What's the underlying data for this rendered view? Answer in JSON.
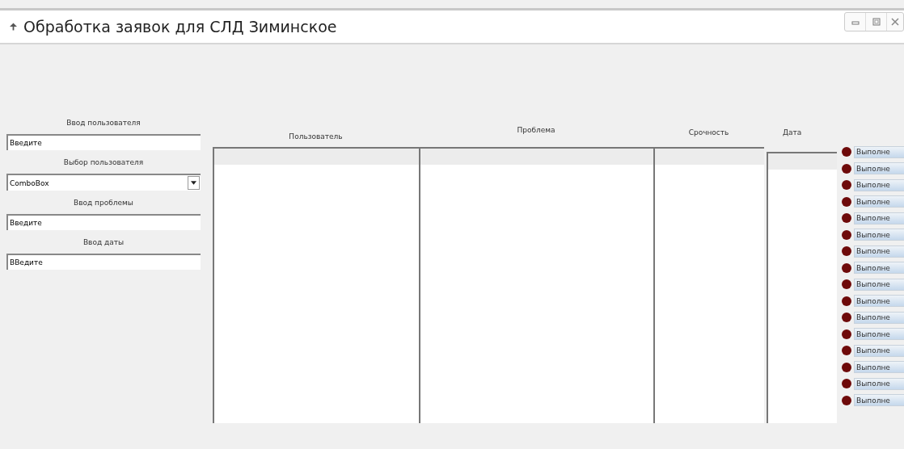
{
  "window": {
    "title": "Обработка заявок для СЛД Зиминское"
  },
  "form": [
    {
      "label": "Ввод пользователя",
      "kind": "text",
      "value": "Введите"
    },
    {
      "label": "Выбор пользователя",
      "kind": "combo",
      "value": "ComboBox"
    },
    {
      "label": "Ввод проблемы",
      "kind": "text",
      "value": "Введите"
    },
    {
      "label": "Ввод даты",
      "kind": "text",
      "value": "ВВедите"
    }
  ],
  "columns": [
    {
      "header": "Пользователь"
    },
    {
      "header": "Проблема"
    },
    {
      "header": "Срочность"
    },
    {
      "header": "Дата"
    }
  ],
  "actions": [
    "Выполне",
    "Выполне",
    "Выполне",
    "Выполне",
    "Выполне",
    "Выполне",
    "Выполне",
    "Выполне",
    "Выполне",
    "Выполне",
    "Выполне",
    "Выполне",
    "Выполне",
    "Выполне",
    "Выполне",
    "Выполне"
  ]
}
